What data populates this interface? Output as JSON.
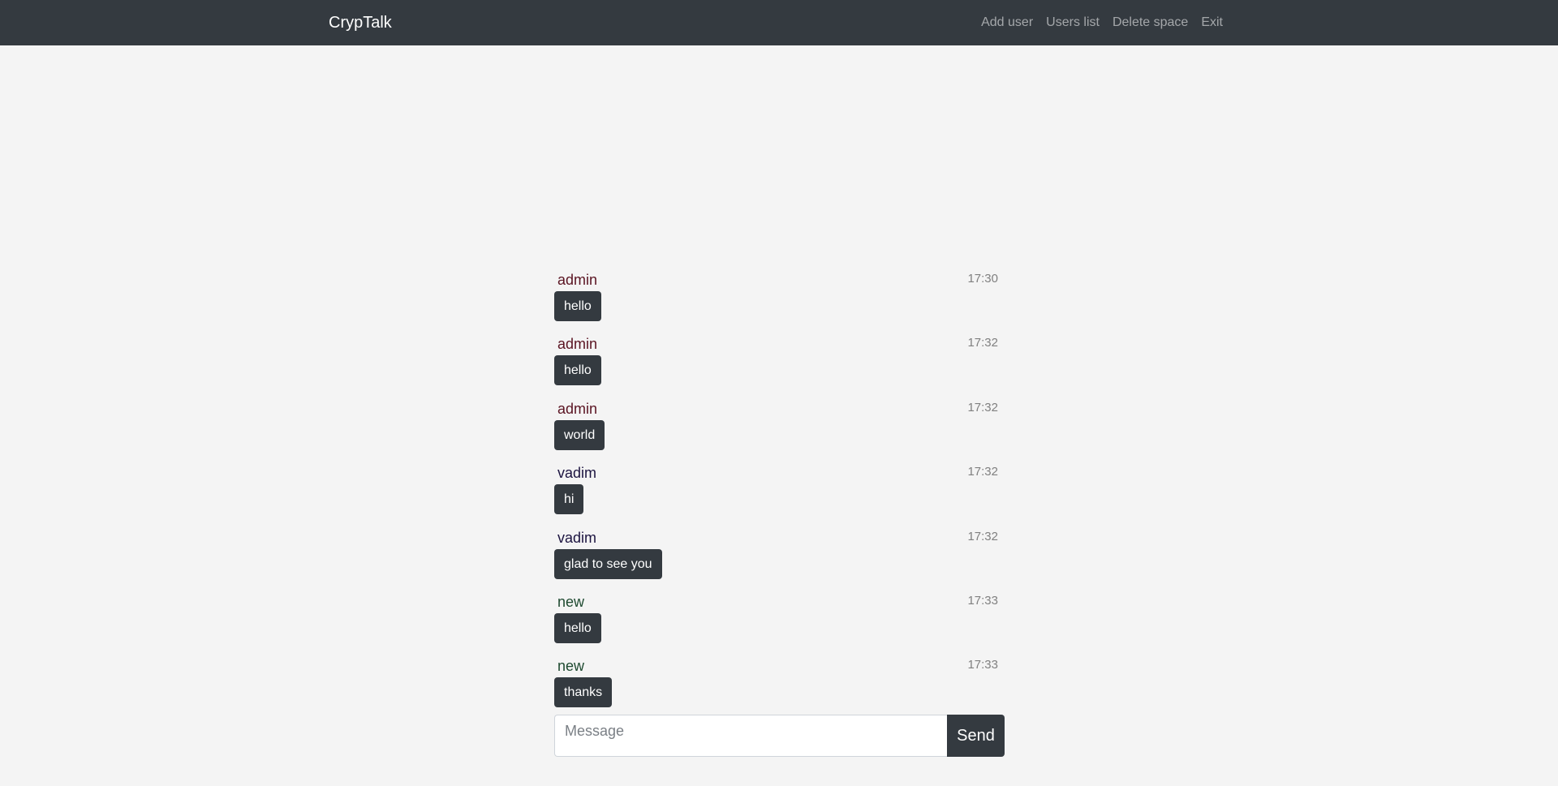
{
  "navbar": {
    "brand": "CrypTalk",
    "links": [
      "Add user",
      "Users list",
      "Delete space",
      "Exit"
    ]
  },
  "colors": {
    "navbar_bg": "#343a40",
    "page_bg": "#f4f4f4",
    "bubble_bg": "#343a40",
    "author_admin": "#5a1422",
    "author_vadim": "#1c1440",
    "author_new": "#1e4a30"
  },
  "messages": [
    {
      "author": "admin",
      "time": "17:30",
      "text": "hello",
      "author_color": "#5a1422"
    },
    {
      "author": "admin",
      "time": "17:32",
      "text": "hello",
      "author_color": "#5a1422"
    },
    {
      "author": "admin",
      "time": "17:32",
      "text": "world",
      "author_color": "#5a1422"
    },
    {
      "author": "vadim",
      "time": "17:32",
      "text": "hi",
      "author_color": "#1c1440"
    },
    {
      "author": "vadim",
      "time": "17:32",
      "text": "glad to see you",
      "author_color": "#1c1440"
    },
    {
      "author": "new",
      "time": "17:33",
      "text": "hello",
      "author_color": "#1e4a30"
    },
    {
      "author": "new",
      "time": "17:33",
      "text": "thanks",
      "author_color": "#1e4a30"
    }
  ],
  "composer": {
    "placeholder": "Message",
    "value": "",
    "send_label": "Send"
  }
}
